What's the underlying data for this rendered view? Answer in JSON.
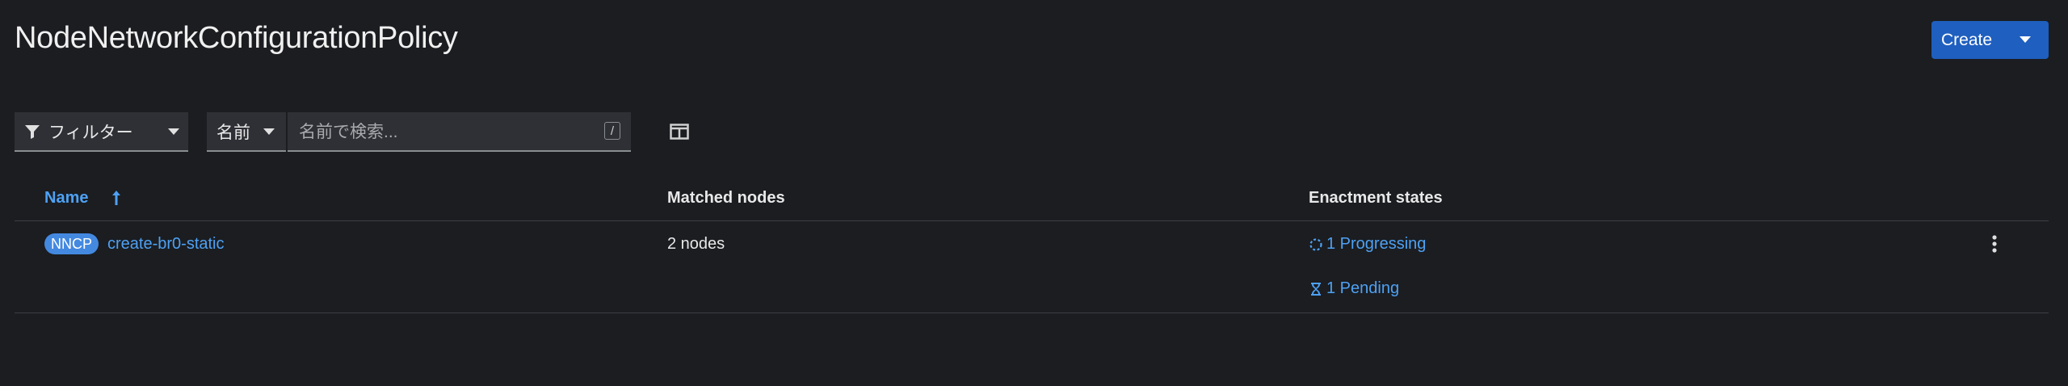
{
  "page": {
    "title": "NodeNetworkConfigurationPolicy",
    "create_label": "Create"
  },
  "toolbar": {
    "filter_label": "フィルター",
    "attribute_label": "名前",
    "search_placeholder": "名前で検索...",
    "search_value": "",
    "shortcut_hint": "/"
  },
  "table": {
    "columns": [
      "Name",
      "Matched nodes",
      "Enactment states"
    ],
    "rows": [
      {
        "badge": "NNCP",
        "name": "create-br0-static",
        "matched_nodes": "2 nodes",
        "states": [
          {
            "icon": "in-progress-icon",
            "label": "1 Progressing"
          },
          {
            "icon": "hourglass-icon",
            "label": "1 Pending"
          }
        ]
      }
    ]
  },
  "colors": {
    "background": "#1b1d21",
    "primary_button": "#1f5fbf",
    "link": "#4ea1f3",
    "badge": "#4489e0"
  }
}
